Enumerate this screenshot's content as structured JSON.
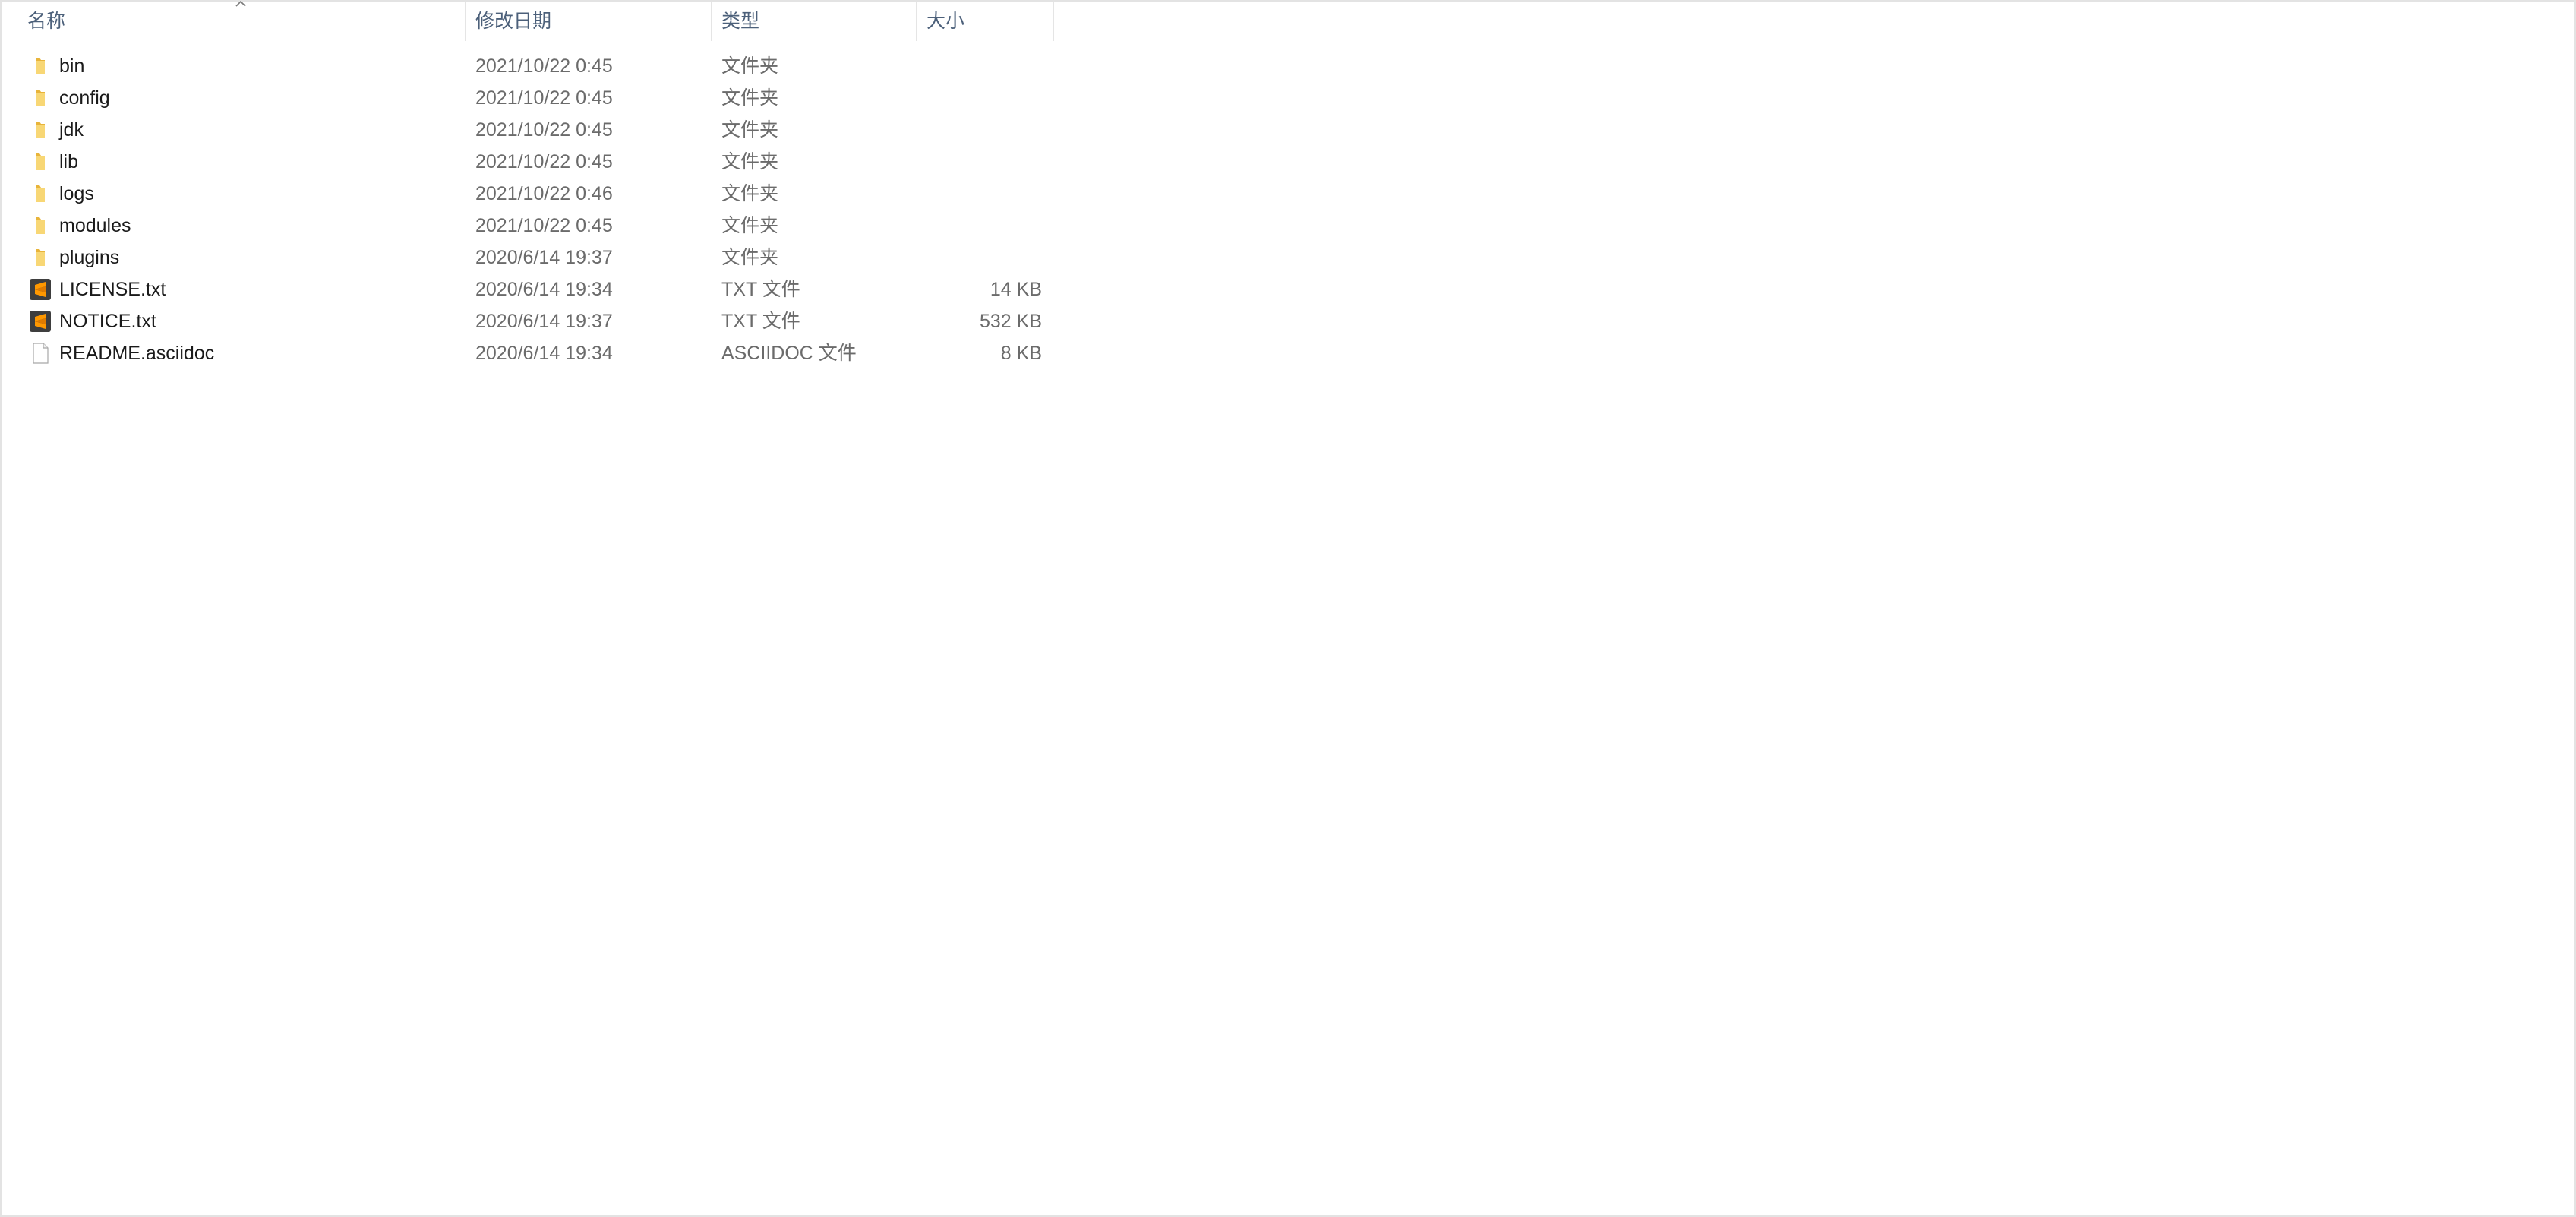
{
  "columns": {
    "name": "名称",
    "date": "修改日期",
    "type": "类型",
    "size": "大小"
  },
  "sort": {
    "column": "name",
    "icon": "sort-up-chevron-icon"
  },
  "files": [
    {
      "name": "bin",
      "date": "2021/10/22 0:45",
      "type": "文件夹",
      "size": "",
      "icon": "folder-icon"
    },
    {
      "name": "config",
      "date": "2021/10/22 0:45",
      "type": "文件夹",
      "size": "",
      "icon": "folder-icon"
    },
    {
      "name": "jdk",
      "date": "2021/10/22 0:45",
      "type": "文件夹",
      "size": "",
      "icon": "folder-icon"
    },
    {
      "name": "lib",
      "date": "2021/10/22 0:45",
      "type": "文件夹",
      "size": "",
      "icon": "folder-icon"
    },
    {
      "name": "logs",
      "date": "2021/10/22 0:46",
      "type": "文件夹",
      "size": "",
      "icon": "folder-icon"
    },
    {
      "name": "modules",
      "date": "2021/10/22 0:45",
      "type": "文件夹",
      "size": "",
      "icon": "folder-icon"
    },
    {
      "name": "plugins",
      "date": "2020/6/14 19:37",
      "type": "文件夹",
      "size": "",
      "icon": "folder-icon"
    },
    {
      "name": "LICENSE.txt",
      "date": "2020/6/14 19:34",
      "type": "TXT 文件",
      "size": "14 KB",
      "icon": "sublime-text-file-icon"
    },
    {
      "name": "NOTICE.txt",
      "date": "2020/6/14 19:37",
      "type": "TXT 文件",
      "size": "532 KB",
      "icon": "sublime-text-file-icon"
    },
    {
      "name": "README.asciidoc",
      "date": "2020/6/14 19:34",
      "type": "ASCIIDOC 文件",
      "size": "8 KB",
      "icon": "blank-file-icon"
    }
  ],
  "colors": {
    "header_text": "#4c607a",
    "folder_yellow": "#f8d775",
    "sublime_orange": "#ff9800"
  }
}
